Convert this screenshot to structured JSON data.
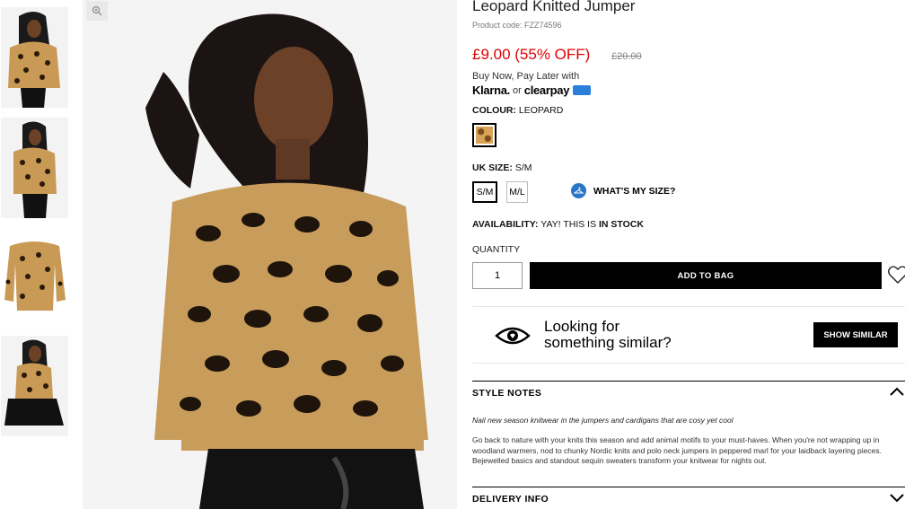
{
  "product": {
    "title": "Leopard Knitted Jumper",
    "code": "Product code: FZZ74596",
    "price": "£9.00 (55% OFF)",
    "old_price": "£20.00"
  },
  "payment": {
    "bnpl_text": "Buy Now, Pay Later with",
    "klarna": "Klarna.",
    "or": "or",
    "clearpay": "clearpay"
  },
  "colour": {
    "label": "COLOUR:",
    "value": "LEOPARD"
  },
  "size": {
    "label": "UK SIZE:",
    "selected": "S/M",
    "options": [
      "S/M",
      "M/L"
    ],
    "whats_my_size": "WHAT'S MY SIZE?"
  },
  "availability": {
    "label": "AVAILABILITY:",
    "text": "YAY! THIS IS",
    "status": "IN STOCK"
  },
  "quantity": {
    "label": "QUANTITY",
    "value": "1"
  },
  "actions": {
    "add_to_bag": "ADD TO BAG",
    "show_similar": "SHOW SIMILAR"
  },
  "similar": {
    "line1": "Looking for",
    "line2": "something similar?"
  },
  "style_notes": {
    "title": "STYLE NOTES",
    "tagline": "Nail new season knitwear in the jumpers and cardigans that are cosy yet cool",
    "body": "Go back to nature with your knits this season and add animal motifs to your must-haves. When you're not wrapping up in woodland warmers, nod to chunky Nordic knits and polo neck jumpers in peppered marl for your laidback layering pieces. Bejewelled basics and standout sequin sweaters transform your knitwear for nights out."
  },
  "delivery": {
    "title": "DELIVERY INFO"
  },
  "colors": {
    "price_red": "#e00000",
    "accent_blue": "#2a76c6",
    "camel": "#d9a457"
  }
}
